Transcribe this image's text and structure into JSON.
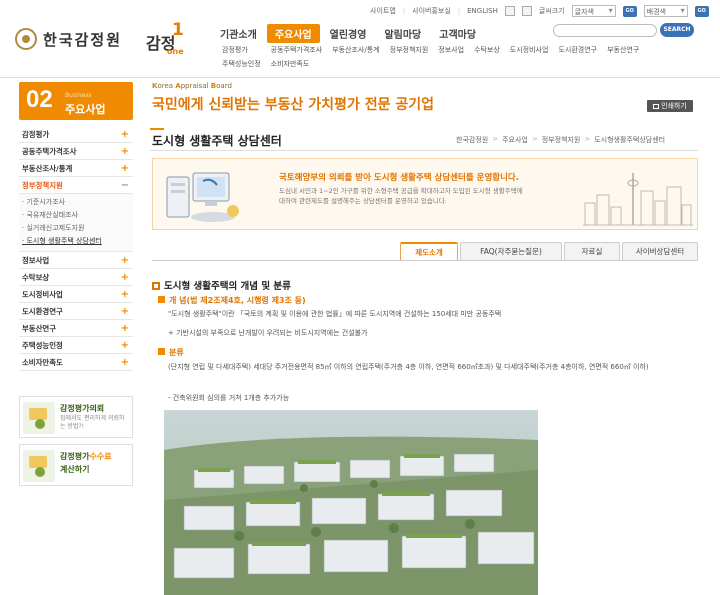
{
  "header": {
    "logo_text": "한국감정원",
    "logo2_text": "감정",
    "logo2_num": "1",
    "logo2_suffix": "one",
    "util": [
      "사이트맵",
      "사이버홍보실",
      "ENGLISH"
    ],
    "font_label": "글씨크기",
    "font_select": "글자색",
    "bg_select": "배경색",
    "go": "GO",
    "search_button": "SEARCH",
    "gnb": [
      "기관소개",
      "주요사업",
      "열린경영",
      "알림마당",
      "고객마당"
    ],
    "gnb_active": 1,
    "subnav": [
      [
        "감정평가",
        "주택성능인정"
      ],
      [
        "공동주택가격조사",
        "소비자만족도"
      ],
      [
        "부동산조사/통계"
      ],
      [
        "정부정책지원"
      ],
      [
        "정보사업"
      ],
      [
        "수탁보상"
      ],
      [
        "도시정비사업"
      ],
      [
        "도시환경연구"
      ],
      [
        "부동산연구"
      ]
    ]
  },
  "left": {
    "section_num": "02",
    "section_en": "Business",
    "section_kr": "주요사업",
    "menu": [
      {
        "label": "감정평가"
      },
      {
        "label": "공동주택가격조사"
      },
      {
        "label": "부동산조사/통계"
      },
      {
        "label": "정부정책지원",
        "active": true,
        "children": [
          "기준시가조사",
          "국유재산실태조사",
          "실거래신고제도지원",
          "도시형 생활주택 상담센터"
        ]
      },
      {
        "label": "정보사업"
      },
      {
        "label": "수탁보상"
      },
      {
        "label": "도시정비사업"
      },
      {
        "label": "도시환경연구"
      },
      {
        "label": "부동산연구"
      },
      {
        "label": "주택성능인정"
      },
      {
        "label": "소비자만족도"
      }
    ],
    "banner1": {
      "title": "감정평가의뢰",
      "desc": "집에서도 편리하게 의뢰하는 방법?!"
    },
    "banner2": {
      "title_a": "감정평가",
      "title_b": "수수료",
      "title_c": "계산하기"
    }
  },
  "content": {
    "board_en_a": "K",
    "board_en_b": "orea ",
    "board_en_c": "A",
    "board_en_d": "ppraisal ",
    "board_en_e": "B",
    "board_en_f": "oard",
    "tagline": "국민에게 신뢰받는 부동산 가치평가 전문 공기업",
    "print": "인쇄하기",
    "page_title": "도시형 생활주택 상담센터",
    "breadcrumb": [
      "한국감정원",
      "주요사업",
      "정부정책지원",
      "도시형생활주택상담센터"
    ],
    "intro_lead": "국토해양부의 의뢰를 받아 도시형 생활주택 상담센터를 운영합니다.",
    "intro_desc": "도심내 서민과 1~2인 가구를 위한 소형주택 공급을 확대하고자 도입된 도시형 생활주택에 대하여 관련제도를 설명해주는 상담센터를 운영하고 있습니다.",
    "tabs": [
      {
        "label": "제도소개",
        "active": true
      },
      {
        "label": "FAQ(자주묻는질문)"
      },
      {
        "label": "자료실"
      },
      {
        "label": "사이버상담센터"
      }
    ],
    "section_title": "도시형 생활주택의 개념 및 분류",
    "concept_title": "개 념(법 제2조제4호, 시행령 제3조 등)",
    "concept_line1": "\"도시형 생활주택\"이란 「국토의 계획 및 이용에 관한 법률」에 따른 도시지역에 건설하는 150세대 미만 공동주택",
    "concept_line2": "+ 기반시설의 부족으로 난개발이 우려되는 비도시지역에는 건설불가",
    "class_title": "분류",
    "class_desc": "(단지형 연립 및 다세대주택) 세대당 주거전용면적 85㎡ 이하의 연립주택(주거층 4층 이하, 연면적 660㎡초과) 및 다세대주택(주거층 4층이하, 연면적 660㎡ 이하)",
    "class_note": "- 건축위원회 심의를 거쳐 1개층 추가가능"
  },
  "colors": {
    "accent": "#f08a00",
    "tagline": "#e07400",
    "link_blue": "#3a73b5"
  }
}
